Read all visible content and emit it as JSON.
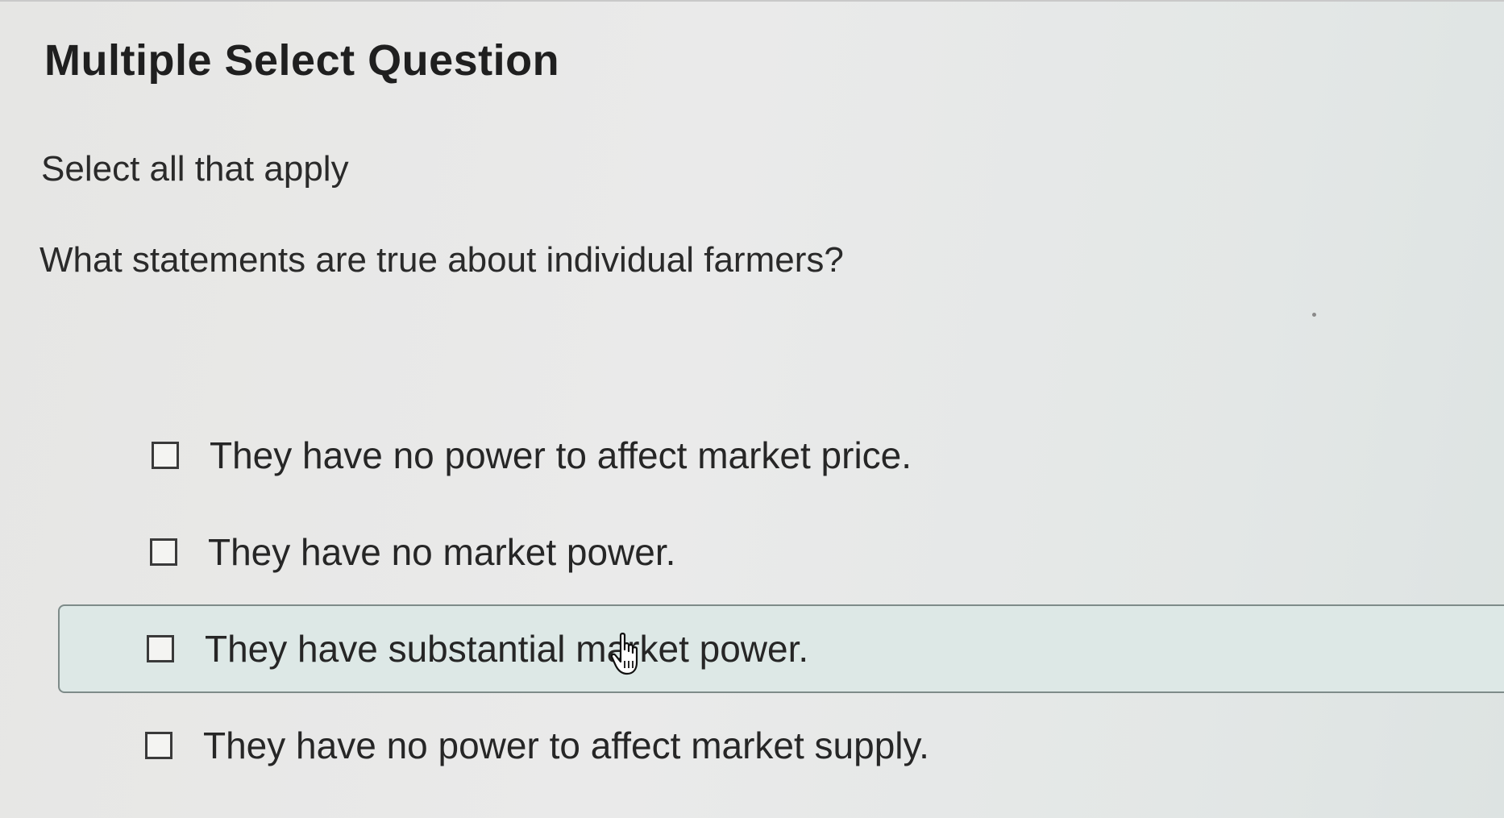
{
  "question": {
    "title": "Multiple Select Question",
    "instruction": "Select all that apply",
    "prompt": "What statements are true about individual farmers?"
  },
  "options": [
    {
      "label": "They have no power to affect market price.",
      "checked": false
    },
    {
      "label": "They have no market power.",
      "checked": false
    },
    {
      "label": "They have substantial market power.",
      "checked": false,
      "hovered": true
    },
    {
      "label": "They have no power to affect market supply.",
      "checked": false
    }
  ],
  "colors": {
    "hover_background": "#dde8e6",
    "hover_border": "#7e8b89",
    "text": "#262626"
  },
  "icons": {
    "cursor": "hand-pointer-icon",
    "checkbox": "empty-checkbox-icon"
  }
}
